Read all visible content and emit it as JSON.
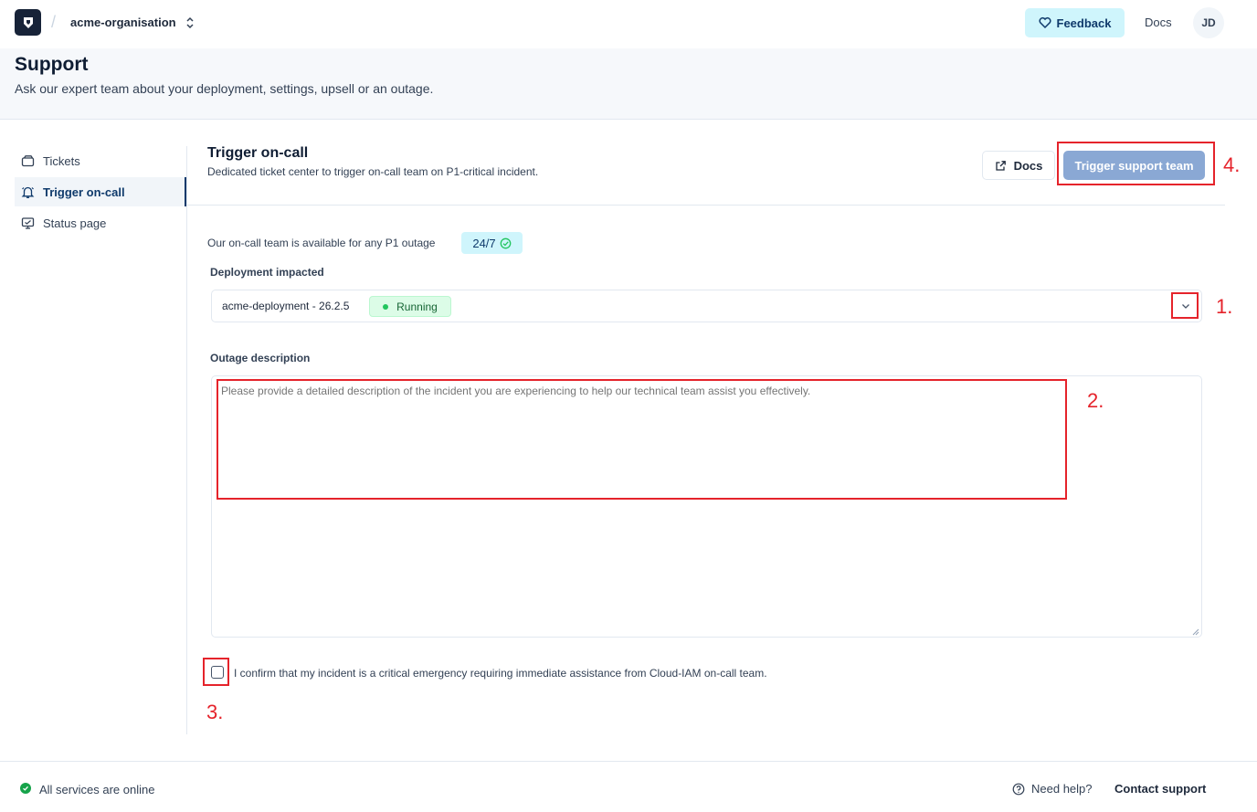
{
  "topbar": {
    "org_name": "acme-organisation",
    "feedback_label": "Feedback",
    "docs_label": "Docs",
    "avatar_initials": "JD"
  },
  "header": {
    "title": "Support",
    "subtitle": "Ask our expert team about your deployment, settings, upsell or an outage."
  },
  "sidebar": {
    "items": [
      {
        "label": "Tickets",
        "icon": "ticket-icon"
      },
      {
        "label": "Trigger on-call",
        "icon": "bell-icon",
        "active": true
      },
      {
        "label": "Status page",
        "icon": "monitor-icon"
      }
    ]
  },
  "main": {
    "title": "Trigger on-call",
    "subtitle": "Dedicated ticket center to trigger on-call team on P1-critical incident.",
    "docs_label": "Docs",
    "trigger_label": "Trigger support team",
    "availability_text": "Our on-call team is available for any P1 outage",
    "availability_badge": "24/7",
    "deployment_label": "Deployment impacted",
    "deployment_value": "acme-deployment - 26.2.5",
    "deployment_status": "Running",
    "outage_label": "Outage description",
    "outage_placeholder": "Please provide a detailed description of the incident you are experiencing to help our technical team assist you effectively.",
    "outage_value": "",
    "confirm_text": "I confirm that my incident is a critical emergency requiring immediate assistance from Cloud-IAM on-call team.",
    "confirm_checked": false
  },
  "annotations": [
    "1.",
    "2.",
    "3.",
    "4."
  ],
  "footer": {
    "status": "All services are online",
    "help": "Need help?",
    "contact": "Contact support"
  },
  "colors": {
    "primary": "#0f3a6b",
    "annotation": "#e5232b",
    "accent_bg": "#cff5fc",
    "running_green": "#22c55e"
  }
}
